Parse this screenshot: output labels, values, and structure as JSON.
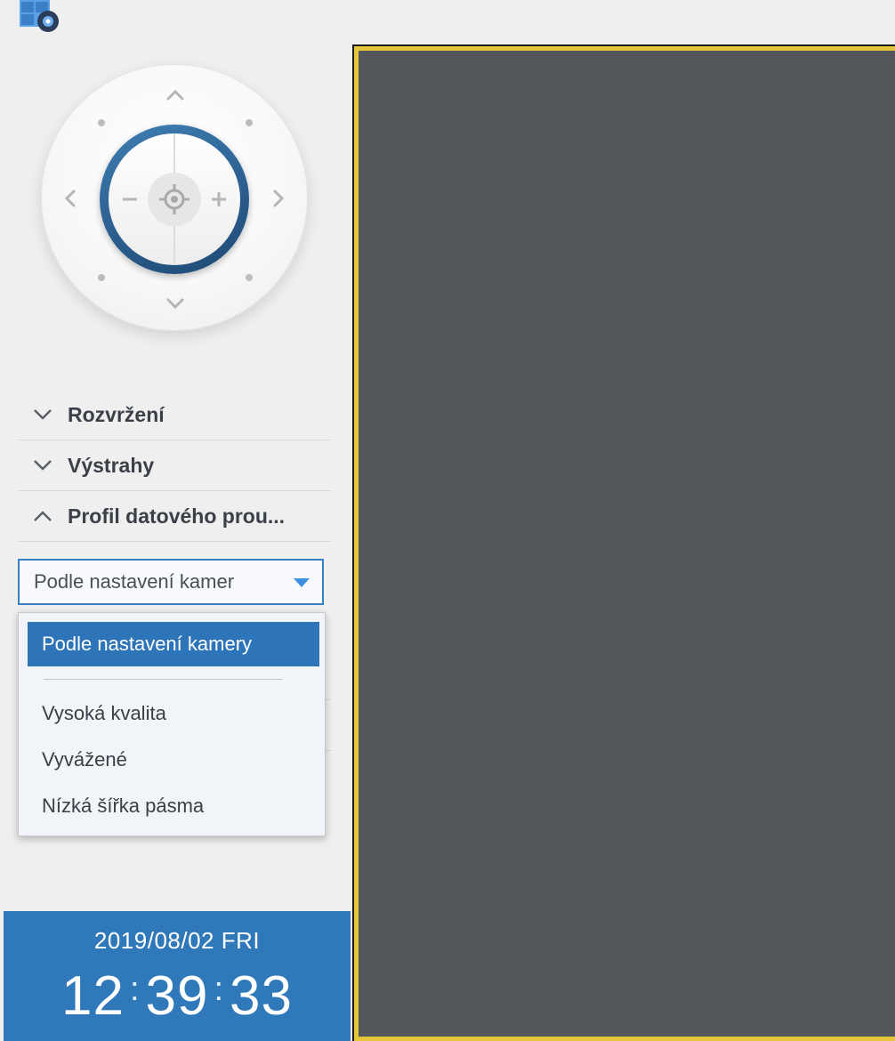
{
  "app": {
    "icon": "surveillance-station-icon"
  },
  "ptz": {
    "buttons": [
      "arrow-up",
      "arrow-down",
      "arrow-left",
      "arrow-right",
      "zoom-out",
      "zoom-in",
      "home-target"
    ]
  },
  "accordion": {
    "items": [
      {
        "label": "Rozvržení",
        "expanded": false
      },
      {
        "label": "Výstrahy",
        "expanded": false
      },
      {
        "label": "Profil datového prou...",
        "expanded": true
      }
    ]
  },
  "stream_profile": {
    "selected": "Podle nastavení kamer",
    "options": [
      {
        "label": "Podle nastavení kamery",
        "selected": true
      },
      {
        "label": "Vysoká kvalita"
      },
      {
        "label": "Vyvážené"
      },
      {
        "label": "Nízká šířka pásma"
      }
    ]
  },
  "clock": {
    "date": "2019/08/02  FRI",
    "hours": "12",
    "minutes": "39",
    "seconds": "33"
  },
  "colors": {
    "accent": "#2f78ba",
    "selection": "#2e74b8",
    "frame_highlight": "#e6c53a",
    "video_bg": "#53565a"
  }
}
